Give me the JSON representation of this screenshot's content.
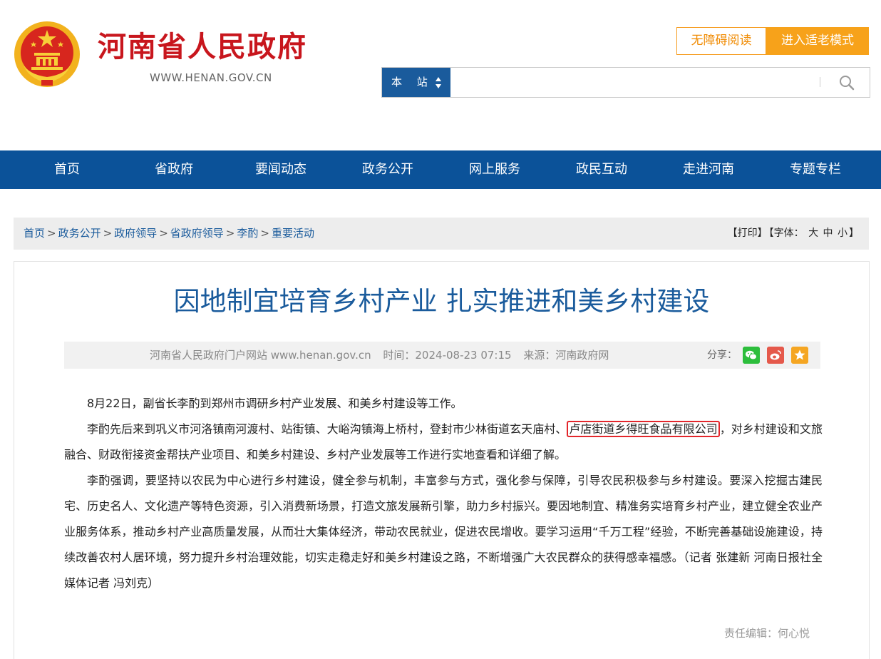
{
  "header": {
    "site_name": "河南省人民政府",
    "site_url": "WWW.HENAN.GOV.CN",
    "accessibility_label": "无障碍阅读",
    "elder_mode_label": "进入适老模式",
    "search_scope": "本 站",
    "search_value": ""
  },
  "nav": [
    "首页",
    "省政府",
    "要闻动态",
    "政务公开",
    "网上服务",
    "政民互动",
    "走进河南",
    "专题专栏"
  ],
  "breadcrumb": {
    "items": [
      "首页",
      "政务公开",
      "政府领导",
      "省政府领导",
      "李酌",
      "重要活动"
    ],
    "separator": ">"
  },
  "tools": {
    "print": "【打印】",
    "font_prefix": "【字体：",
    "font_large": "大",
    "font_medium": "中",
    "font_small": "小",
    "font_suffix": "】"
  },
  "article": {
    "title": "因地制宜培育乡村产业 扎实推进和美乡村建设",
    "source_site": "河南省人民政府门户网站 www.henan.gov.cn",
    "time": "时间：2024-08-23 07:15",
    "origin": "来源：河南政府网",
    "share_label": "分享：",
    "p1": "8月22日，副省长李酌到郑州市调研乡村产业发展、和美乡村建设等工作。",
    "p2_before": "李酌先后来到巩义市河洛镇南河渡村、站街镇、大峪沟镇海上桥村，登封市少林街道玄天庙村、",
    "p2_highlight": "卢店街道乡得旺食品有限公司",
    "p2_after": "，对乡村建设和文旅融合、财政衔接资金帮扶产业项目、和美乡村建设、乡村产业发展等工作进行实地查看和详细了解。",
    "p3": "李酌强调，要坚持以农民为中心进行乡村建设，健全参与机制，丰富参与方式，强化参与保障，引导农民积极参与乡村建设。要深入挖掘古建民宅、历史名人、文化遗产等特色资源，引入消费新场景，打造文旅发展新引擎，助力乡村振兴。要因地制宜、精准务实培育乡村产业，建立健全农业产业服务体系，推动乡村产业高质量发展，从而壮大集体经济，带动农民就业，促进农民增收。要学习运用“千万工程”经验，不断完善基础设施建设，持续改善农村人居环境，努力提升乡村治理效能，切实走稳走好和美乡村建设之路，不断增强广大农民群众的获得感幸福感。（记者 张建新 河南日报社全媒体记者 冯刘克）",
    "editor": "责任编辑：何心悦"
  },
  "colors": {
    "brand_red": "#c8161d",
    "nav_blue": "#0b5299",
    "title_blue": "#1a5b9c",
    "accent_orange": "#f7a21a",
    "highlight_red": "#e3262b"
  },
  "icons": {
    "emblem": "national-emblem-icon",
    "search": "search-icon",
    "wechat": "wechat-icon",
    "weibo": "weibo-icon",
    "favorite": "star-icon"
  }
}
